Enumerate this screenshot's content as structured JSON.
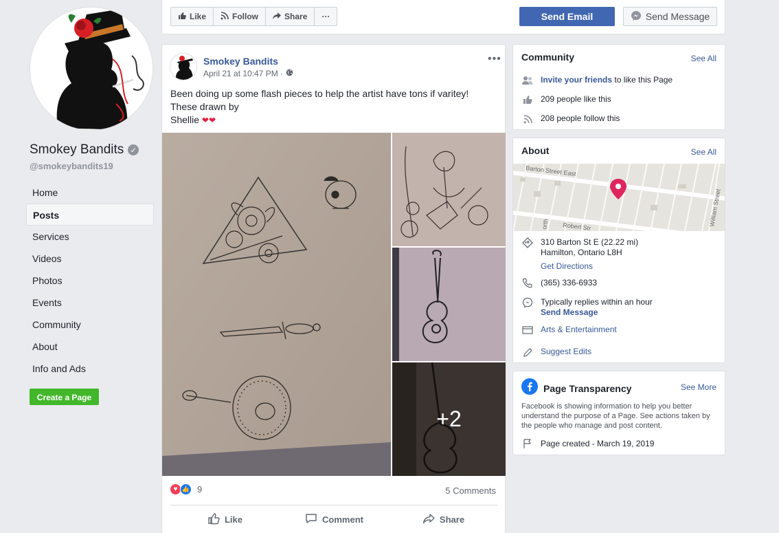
{
  "page": {
    "name": "Smokey Bandits",
    "handle": "@smokeybandits19"
  },
  "nav": [
    {
      "label": "Home"
    },
    {
      "label": "Posts"
    },
    {
      "label": "Services"
    },
    {
      "label": "Videos"
    },
    {
      "label": "Photos"
    },
    {
      "label": "Events"
    },
    {
      "label": "Community"
    },
    {
      "label": "About"
    },
    {
      "label": "Info and Ads"
    }
  ],
  "create_page_label": "Create a Page",
  "topbar": {
    "like": "Like",
    "follow": "Follow",
    "share": "Share",
    "more": "···",
    "send_email": "Send Email",
    "send_message": "Send Message"
  },
  "post": {
    "author": "Smokey Bandits",
    "time": "April 21 at 10:47 PM ·",
    "more": "•••",
    "text_line1": "Been doing up some flash pieces to help the artist have tons if varitey!",
    "text_line2": "These drawn by",
    "text_line3": "Shellie",
    "extra_photos": "+2",
    "reaction_count": "9",
    "comments": "5 Comments",
    "action_like": "Like",
    "action_comment": "Comment",
    "action_share": "Share"
  },
  "community": {
    "title": "Community",
    "see_all": "See All",
    "invite_bold": "Invite your friends",
    "invite_rest": "to like this Page",
    "likes": "209 people like this",
    "follows": "208 people follow this"
  },
  "about": {
    "title": "About",
    "see_all": "See All",
    "map_street1": "Barton Street East",
    "map_street2": "Robert Str",
    "map_street3": "William Street",
    "map_street4": "orth",
    "address1": "310 Barton St E (22.22 mi)",
    "address2": "Hamilton, Ontario L8H",
    "directions": "Get Directions",
    "phone": "(365) 336-6933",
    "replies": "Typically replies within an hour",
    "send_message": "Send Message",
    "category": "Arts & Entertainment",
    "suggest": "Suggest Edits"
  },
  "transparency": {
    "title": "Page Transparency",
    "see_more": "See More",
    "desc": "Facebook is showing information to help you better understand the purpose of a Page. See actions taken by the people who manage and post content.",
    "created": "Page created - March 19, 2019"
  },
  "colors": {
    "brand": "#4267b2",
    "link": "#385898",
    "green": "#42b72a",
    "pin": "#e0245e"
  }
}
